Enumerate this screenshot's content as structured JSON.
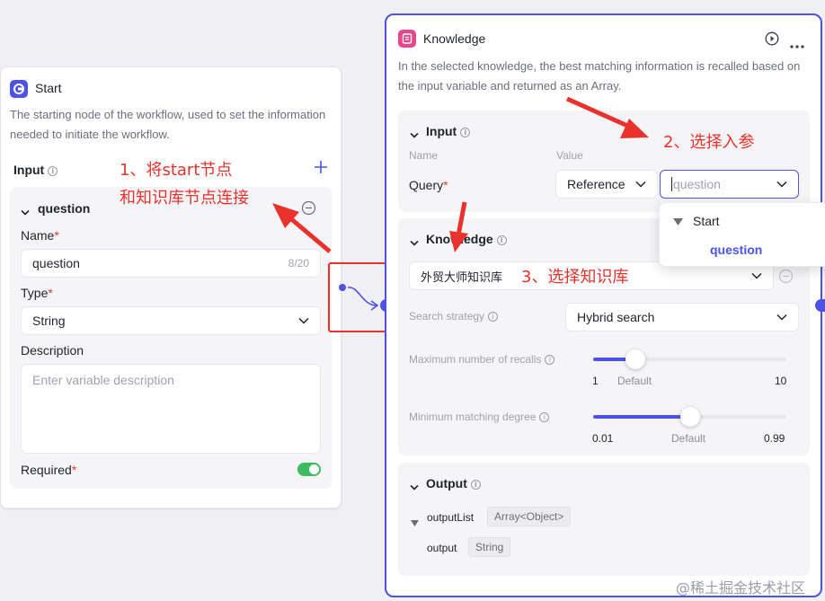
{
  "start_node": {
    "title": "Start",
    "description": "The starting node of the workflow, used to set the information needed to initiate the workflow.",
    "input_label": "Input",
    "variable": {
      "name_header": "question",
      "name_label": "Name",
      "name_value": "question",
      "name_count": "8/20",
      "type_label": "Type",
      "type_value": "String",
      "description_label": "Description",
      "description_placeholder": "Enter variable description",
      "required_label": "Required",
      "required": true
    },
    "required_mark": "*"
  },
  "knowledge_node": {
    "title": "Knowledge",
    "description": "In the selected knowledge, the best matching information is recalled based on the input variable and returned as an Array.",
    "input": {
      "title": "Input",
      "name_col": "Name",
      "value_col": "Value",
      "query_label": "Query",
      "source_value": "Reference",
      "variable_placeholder": "question"
    },
    "dropdown": {
      "group": "Start",
      "option": "question"
    },
    "knowledge": {
      "title": "Knowledge",
      "selected": "外贸大师知识库"
    },
    "search_strategy_label": "Search strategy",
    "search_strategy_value": "Hybrid search",
    "max_recalls": {
      "label": "Maximum number of recalls",
      "min": "1",
      "default": "Default",
      "max": "10",
      "value_fraction": 0.22
    },
    "min_degree": {
      "label": "Minimum matching degree",
      "min": "0.01",
      "default": "Default",
      "max": "0.99",
      "value_fraction": 0.5
    },
    "output": {
      "title": "Output",
      "list_name": "outputList",
      "list_type": "Array<Object>",
      "child_name": "output",
      "child_type": "String"
    }
  },
  "annotations": {
    "step1_line1": "1、将start节点",
    "step1_line2": "和知识库节点连接",
    "step2": "2、选择入参",
    "step3": "3、选择知识库"
  },
  "watermark": "@稀土掘金技术社区",
  "colors": {
    "accent": "#4d53e8",
    "annotation": "#e8322b",
    "toggle_on": "#3dbb61",
    "knowledge_icon": "#e8478a"
  }
}
